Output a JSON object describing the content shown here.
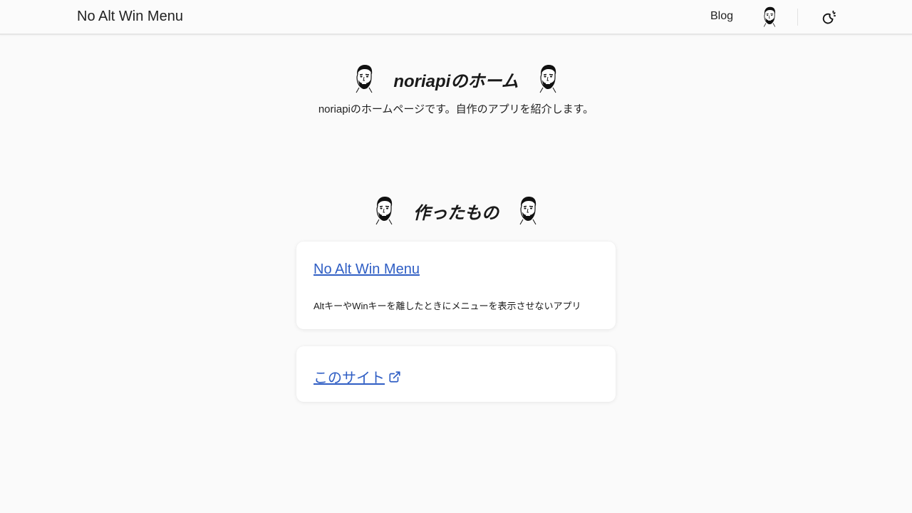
{
  "navbar": {
    "brand": "No Alt Win Menu",
    "blog_link": "Blog",
    "avatar_icon": "bearded-face-avatar",
    "theme_toggle_icon": "moon-sun-theme-icon"
  },
  "hero": {
    "title": "noriapiのホーム",
    "subtitle": "noriapiのホームページです。自作のアプリを紹介します。",
    "decor_icon": "bearded-face-icon"
  },
  "works": {
    "title": "作ったもの",
    "items": [
      {
        "name": "No Alt Win Menu",
        "description": "AltキーやWinキーを離したときにメニューを表示させないアプリ"
      },
      {
        "name": "このサイト",
        "icon": "external-link-icon"
      }
    ]
  },
  "colors": {
    "link": "#2f5ec4",
    "background": "#fafafa",
    "card": "#ffffff"
  }
}
